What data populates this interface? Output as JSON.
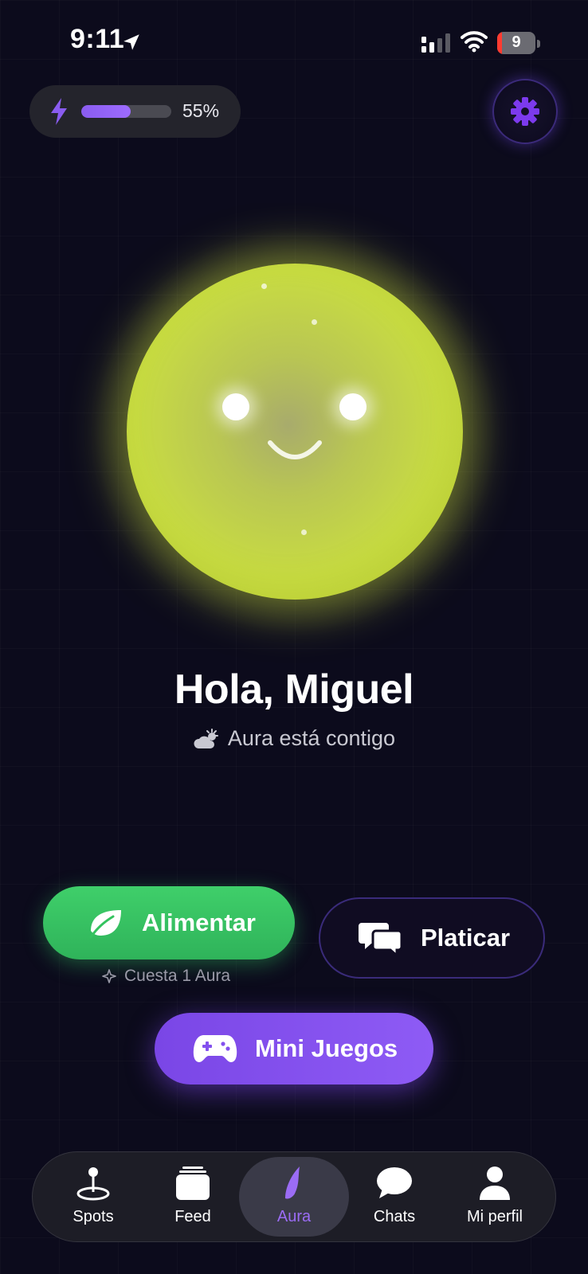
{
  "status_bar": {
    "time": "9:11",
    "battery": "9",
    "icons": [
      "location-arrow-icon",
      "cellular-signal-icon",
      "wifi-icon",
      "battery-icon"
    ]
  },
  "energy": {
    "percent_label": "55%",
    "level": 0.55,
    "icon": "bolt-icon",
    "accent": "#8a5cf0"
  },
  "settings": {
    "icon": "gear-icon",
    "accent": "#7c3aed"
  },
  "aura": {
    "orb_color": "#cfe240",
    "greeting": "Hola, Miguel",
    "subtitle": "Aura está contigo",
    "subtitle_icon": "partly-cloudy-icon"
  },
  "actions": {
    "feed": {
      "label": "Alimentar",
      "icon": "leaf-icon",
      "color": "#34c35f",
      "cost": "Cuesta 1 Aura"
    },
    "chat": {
      "label": "Platicar",
      "icon": "chat-bubbles-icon"
    },
    "games": {
      "label": "Mini Juegos",
      "icon": "gamepad-icon",
      "color": "#8350ee"
    }
  },
  "tabbar": {
    "items": [
      {
        "label": "Spots",
        "icon": "map-pin-icon",
        "active": false
      },
      {
        "label": "Feed",
        "icon": "stack-icon",
        "active": false
      },
      {
        "label": "Aura",
        "icon": "aura-flame-icon",
        "active": true
      },
      {
        "label": "Chats",
        "icon": "chat-bubble-icon",
        "active": false
      },
      {
        "label": "Mi perfil",
        "icon": "person-icon",
        "active": false
      }
    ],
    "active_color": "#9b6cf5"
  }
}
